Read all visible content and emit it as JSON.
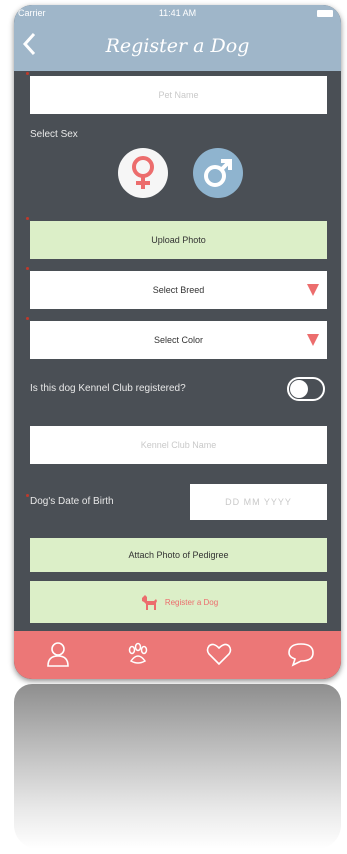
{
  "status_bar": {
    "carrier": "Carrier",
    "time": "11:41 AM"
  },
  "header": {
    "back_icon": "chevron-left-icon",
    "title": "Register a Dog"
  },
  "form": {
    "pet_name_placeholder": "Pet Name",
    "select_sex_label": "Select Sex",
    "female_icon": "female-symbol-icon",
    "male_icon": "male-symbol-icon",
    "upload_photo_label": "Upload Photo",
    "breed_select": "Select Breed",
    "color_select": "Select Color",
    "kennel_question": "Is this dog Kennel Club registered?",
    "kennel_name_placeholder": "Kennel Club Name",
    "dob_label": "Dog's Date of Birth",
    "dob_placeholder": "DD MM YYYY",
    "attach_pedigree_label": "Attach Photo of Pedigree",
    "register_label": "Register a Dog"
  },
  "tabbar": {
    "tabs": [
      {
        "icon": "profile-icon"
      },
      {
        "icon": "paw-icon"
      },
      {
        "icon": "heart-icon"
      },
      {
        "icon": "chat-bubble-icon"
      }
    ]
  },
  "colors": {
    "header_bg": "#9fb6c9",
    "content_bg": "#4a4f55",
    "green_button": "#dcefc8",
    "accent_red": "#ec6d6d",
    "tabbar_bg": "#ec7777"
  }
}
